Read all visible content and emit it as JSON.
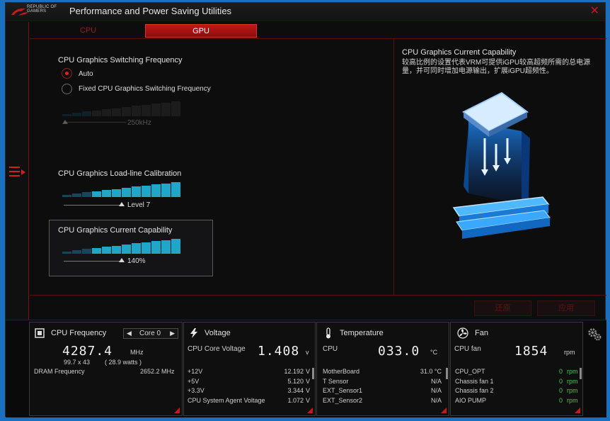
{
  "window": {
    "title": "Performance and Power Saving Utilities",
    "logo_line1": "REPUBLIC OF",
    "logo_line2": "GAMERS"
  },
  "tabs": [
    {
      "label": "CPU"
    },
    {
      "label": "GPU"
    }
  ],
  "switching": {
    "title": "CPU Graphics Switching Frequency",
    "options": [
      {
        "label": "Auto",
        "selected": true
      },
      {
        "label": "Fixed CPU Graphics Switching Frequency",
        "selected": false
      }
    ],
    "value": "250kHz"
  },
  "loadline": {
    "title": "CPU Graphics Load-line Calibration",
    "value": "Level 7"
  },
  "current": {
    "title": "CPU Graphics Current Capability",
    "value": "140%"
  },
  "right": {
    "title": "CPU Graphics Current Capability",
    "desc": "较高比例的设置代表VRM可提供iGPU较高超频所需的总电源量，并可同时增加电源输出，扩展iGPU超频性。"
  },
  "buttons": {
    "undo": "还原",
    "apply": "应用"
  },
  "freq": {
    "title": "CPU Frequency",
    "core": "Core 0",
    "value": "4287.4",
    "unit": "MHz",
    "mult": "99.7  x  43",
    "watts": "( 28.9 watts )",
    "dram_label": "DRAM Frequency",
    "dram_value": "2652.2  MHz"
  },
  "voltage": {
    "title": "Voltage",
    "main_label": "CPU Core Voltage",
    "main_value": "1.408",
    "main_unit": "v",
    "rows": [
      {
        "label": "+12V",
        "value": "12.192",
        "unit": "V"
      },
      {
        "label": "+5V",
        "value": "5.120",
        "unit": "V"
      },
      {
        "label": "+3.3V",
        "value": "3.344",
        "unit": "V"
      },
      {
        "label": "CPU System Agent Voltage",
        "value": "1.072",
        "unit": "V"
      }
    ]
  },
  "temperature": {
    "title": "Temperature",
    "main_label": "CPU",
    "main_value": "033.0",
    "main_unit": "°C",
    "rows": [
      {
        "label": "MotherBoard",
        "value": "31.0 °C"
      },
      {
        "label": "T Sensor",
        "value": "N/A"
      },
      {
        "label": "EXT_Sensor1",
        "value": "N/A"
      },
      {
        "label": "EXT_Sensor2",
        "value": "N/A"
      }
    ]
  },
  "fan": {
    "title": "Fan",
    "main_label": "CPU fan",
    "main_value": "1854",
    "main_unit": "rpm",
    "rows": [
      {
        "label": "CPU_OPT",
        "value": "0",
        "unit": "rpm"
      },
      {
        "label": "Chassis fan 1",
        "value": "0",
        "unit": "rpm"
      },
      {
        "label": "Chassis fan 2",
        "value": "0",
        "unit": "rpm"
      },
      {
        "label": "AIO PUMP",
        "value": "0",
        "unit": "rpm"
      }
    ]
  },
  "colors": {
    "accent": "#c81818",
    "bar": "#1fa7c9",
    "bg": "#0d0d0e"
  }
}
